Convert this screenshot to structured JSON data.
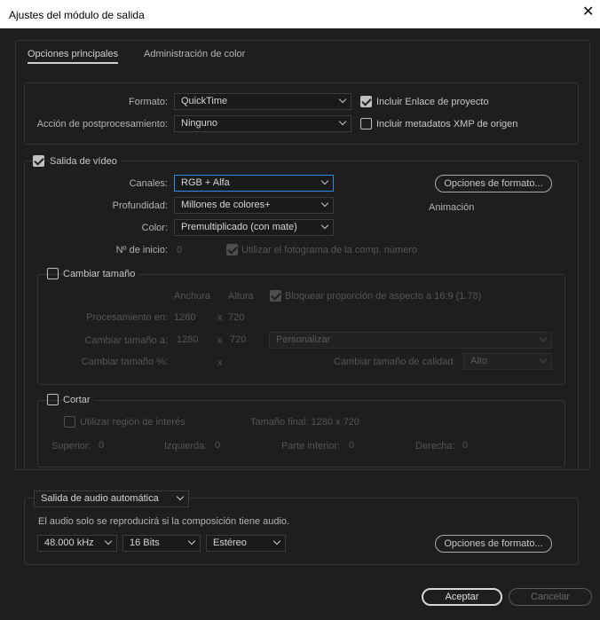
{
  "window": {
    "title": "Ajustes del módulo de salida"
  },
  "tabs": [
    "Opciones principales",
    "Administración de color"
  ],
  "main": {
    "format_label": "Formato:",
    "format_value": "QuickTime",
    "post_label": "Acción de postprocesamiento:",
    "post_value": "Ninguno",
    "include_project_link": "Incluir Enlace de proyecto",
    "include_xmp": "Incluir metadatos XMP de origen"
  },
  "video": {
    "section_label": "Salida de vídeo",
    "channels_label": "Canales:",
    "channels_value": "RGB + Alfa",
    "depth_label": "Profundidad:",
    "depth_value": "Millones de colores+",
    "color_label": "Color:",
    "color_value": "Premultiplicado (con mate)",
    "start_label": "Nº de inicio:",
    "start_value": "0",
    "use_comp_frame": "Utilizar el fotograma de la comp. número",
    "format_options_button": "Opciones de formato...",
    "codec_info": "Animación"
  },
  "resize": {
    "label": "Cambiar tamaño",
    "width_header": "Anchura",
    "height_header": "Altura",
    "lock_aspect": "Bloquear proporción de aspecto a 16:9 (1.78)",
    "rendering_label": "Procesamiento en:",
    "rendering_w": "1280",
    "rendering_h": "720",
    "resize_to_label": "Cambiar tamaño a:",
    "resize_to_w": "1280",
    "resize_to_h": "720",
    "preset_value": "Personalizar",
    "resize_pct_label": "Cambiar tamaño %:",
    "x": "x",
    "quality_label": "Cambiar tamaño de calidad:",
    "quality_value": "Alto"
  },
  "crop": {
    "label": "Cortar",
    "use_roi": "Utilizar región de interés",
    "final_size": "Tamaño final: 1280 x 720",
    "top_label": "Superior:",
    "top_value": "0",
    "left_label": "Izquierda:",
    "left_value": "0",
    "bottom_label": "Parte inferior:",
    "bottom_value": "0",
    "right_label": "Derecha:",
    "right_value": "0"
  },
  "audio": {
    "mode_value": "Salida de audio automática",
    "note": "El audio solo se reproducirá si la composición tiene audio.",
    "rate_value": "48.000 kHz",
    "bits_value": "16 Bits",
    "channels_value": "Estéreo",
    "format_options_button": "Opciones de formato..."
  },
  "footer": {
    "ok": "Aceptar",
    "cancel": "Cancelar"
  }
}
